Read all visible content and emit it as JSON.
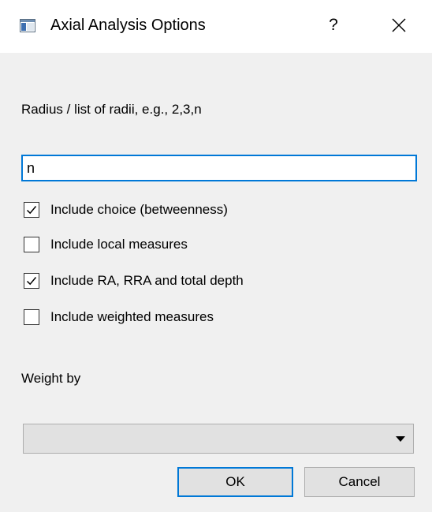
{
  "window": {
    "title": "Axial Analysis Options",
    "help_label": "?",
    "close_label": "×"
  },
  "radius": {
    "label": "Radius / list of radii, e.g., 2,3,n",
    "value": "n"
  },
  "options": [
    {
      "label": "Include choice (betweenness)",
      "checked": true
    },
    {
      "label": "Include local measures",
      "checked": false
    },
    {
      "label": "Include RA, RRA and total depth",
      "checked": true
    },
    {
      "label": "Include weighted measures",
      "checked": false
    }
  ],
  "weight": {
    "label": "Weight by",
    "selected": ""
  },
  "buttons": {
    "ok_label": "OK",
    "cancel_label": "Cancel"
  },
  "colors": {
    "accent": "#0078d7",
    "background": "#f0f0f0",
    "button_face": "#e1e1e1"
  }
}
